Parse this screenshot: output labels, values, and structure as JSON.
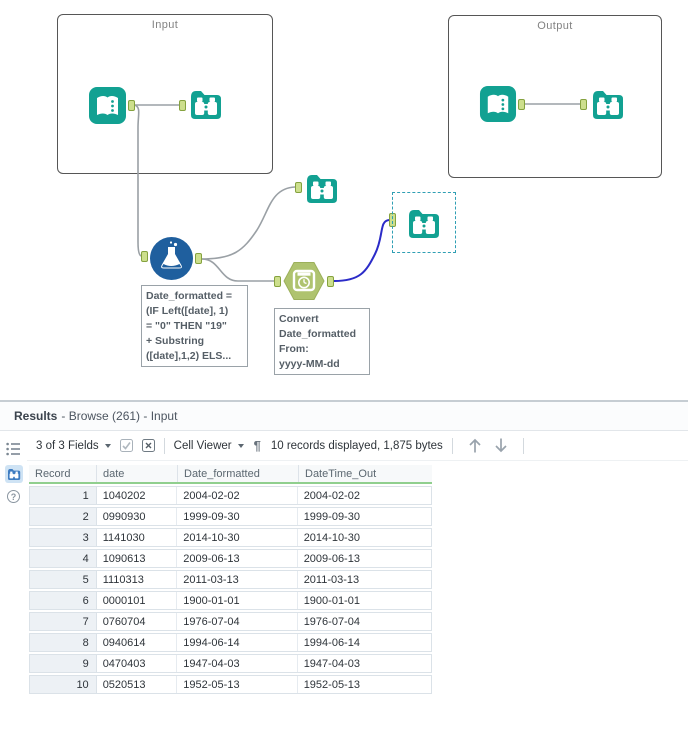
{
  "canvas": {
    "input_container_label": "Input",
    "output_container_label": "Output",
    "formula_annotation_lines": [
      "Date_formatted =",
      "(IF Left([date], 1)",
      "= \"0\" THEN \"19\"",
      "+ Substring",
      "([date],1,2) ELS..."
    ],
    "datetime_annotation_lines": [
      "Convert",
      "Date_formatted",
      "From:",
      "yyyy-MM-dd"
    ]
  },
  "results": {
    "title": {
      "primary": "Results",
      "context": "- Browse (261) - Input"
    },
    "toolbar": {
      "fields_selector": "3 of 3 Fields",
      "viewer_selector": "Cell Viewer",
      "pilcrow": "¶",
      "records_summary": "10 records displayed, 1,875 bytes"
    },
    "help_glyph": "?",
    "table": {
      "headers": [
        "Record",
        "date",
        "Date_formatted",
        "DateTime_Out"
      ],
      "rows": [
        [
          "1",
          "1040202",
          "2004-02-02",
          "2004-02-02"
        ],
        [
          "2",
          "0990930",
          "1999-09-30",
          "1999-09-30"
        ],
        [
          "3",
          "1141030",
          "2014-10-30",
          "2014-10-30"
        ],
        [
          "4",
          "1090613",
          "2009-06-13",
          "2009-06-13"
        ],
        [
          "5",
          "1110313",
          "2011-03-13",
          "2011-03-13"
        ],
        [
          "6",
          "0000101",
          "1900-01-01",
          "1900-01-01"
        ],
        [
          "7",
          "0760704",
          "1976-07-04",
          "1976-07-04"
        ],
        [
          "8",
          "0940614",
          "1994-06-14",
          "1994-06-14"
        ],
        [
          "9",
          "0470403",
          "1947-04-03",
          "1947-04-03"
        ],
        [
          "10",
          "0520513",
          "1952-05-13",
          "1952-05-13"
        ]
      ]
    }
  },
  "colors": {
    "tool_teal": "#12a192",
    "formula_blue": "#1f5f9e",
    "datetime_olive": "#afc36f",
    "anchor_green": "#cddf8d",
    "connection_gray": "#9aa0a5",
    "connection_selected_blue": "#2b2bc8",
    "selection_dashed_teal": "#2f9fb4",
    "header_underline_green": "#90cf8e",
    "active_view_blue": "#3e7cc1"
  }
}
